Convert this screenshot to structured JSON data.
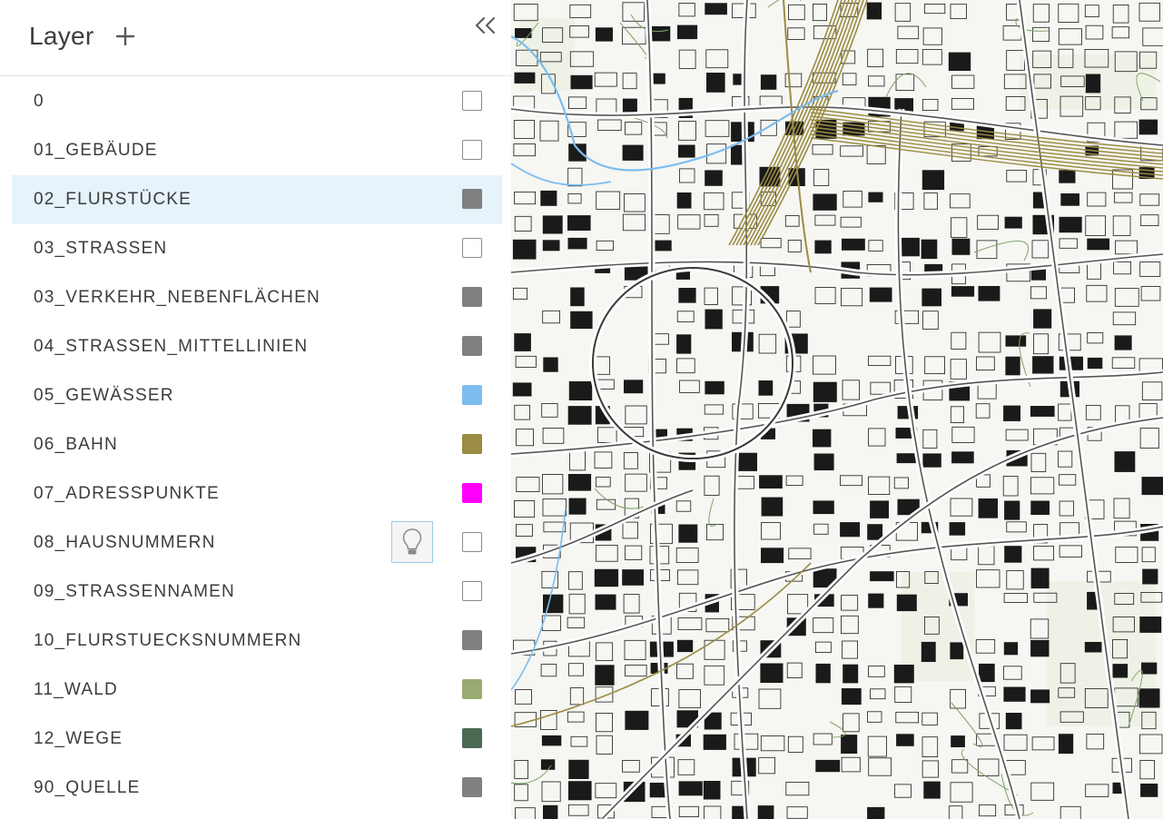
{
  "panel": {
    "title": "Layer",
    "add_icon": "plus-icon",
    "collapse_icon": "double-chevron-left-icon"
  },
  "layers": [
    {
      "name": "0",
      "color": null,
      "selected": false
    },
    {
      "name": "01_GEBÄUDE",
      "color": null,
      "selected": false
    },
    {
      "name": "02_FLURSTÜCKE",
      "color": "#808080",
      "selected": true
    },
    {
      "name": "03_STRASSEN",
      "color": null,
      "selected": false
    },
    {
      "name": "03_VERKEHR_NEBENFLÄCHEN",
      "color": "#808080",
      "selected": false
    },
    {
      "name": "04_STRASSEN_MITTELLINIEN",
      "color": "#808080",
      "selected": false
    },
    {
      "name": "05_GEWÄSSER",
      "color": "#7cbdf0",
      "selected": false
    },
    {
      "name": "06_BAHN",
      "color": "#9a8c44",
      "selected": false
    },
    {
      "name": "07_ADRESSPUNKTE",
      "color": "#ff00ff",
      "selected": false
    },
    {
      "name": "08_HAUSNUMMERN",
      "color": null,
      "selected": false,
      "hover_icon": "lightbulb-icon"
    },
    {
      "name": "09_STRASSENNAMEN",
      "color": null,
      "selected": false
    },
    {
      "name": "10_FLURSTUECKSNUMMERN",
      "color": "#808080",
      "selected": false
    },
    {
      "name": "11_WALD",
      "color": "#97ab72",
      "selected": false
    },
    {
      "name": "12_WEGE",
      "color": "#4b6a54",
      "selected": false
    },
    {
      "name": "90_QUELLE",
      "color": "#808080",
      "selected": false
    }
  ],
  "map": {
    "description_icon": "city-map-view",
    "colors": {
      "buildings": "#1a1a1a",
      "streets": "#555555",
      "rail": "#9a8c44",
      "water": "#7cbdf0",
      "paths": "#7fa36a"
    }
  }
}
